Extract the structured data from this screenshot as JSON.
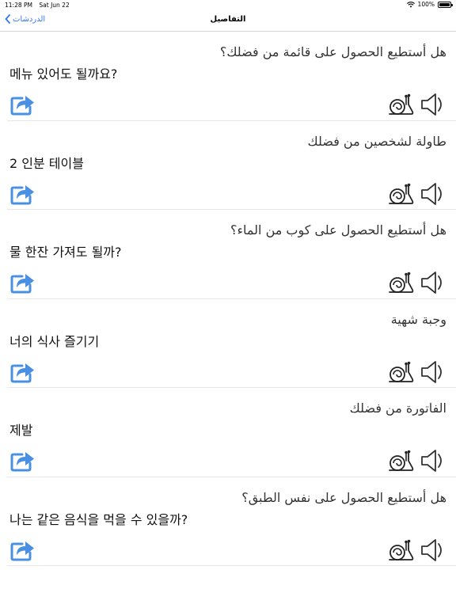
{
  "status": {
    "time": "11:28 PM",
    "date": "Sat Jun 22",
    "battery": "100%"
  },
  "nav": {
    "back_label": "الدردشات",
    "title": "التفاصيل"
  },
  "phrases": [
    {
      "arabic": "هل أستطيع الحصول على قائمة من فضلك؟",
      "korean": "메뉴 있어도 될까요?"
    },
    {
      "arabic": "طاولة لشخصين من فضلك",
      "korean": "2 인분 테이블"
    },
    {
      "arabic": "هل أستطيع الحصول على كوب من الماء؟",
      "korean": "물 한잔 가져도 될까?"
    },
    {
      "arabic": "وجبة شهية",
      "korean": "너의 식사 즐기기"
    },
    {
      "arabic": "الفاتورة من فضلك",
      "korean": "제발"
    },
    {
      "arabic": "هل أستطيع الحصول على نفس الطبق؟",
      "korean": "나는 같은 음식을 먹을 수 있을까?"
    }
  ],
  "colors": {
    "accent": "#3478f6",
    "share_icon": "#4a90e2",
    "divider": "#e6e6e6"
  },
  "icons": {
    "share": "share-arrow-icon",
    "slow": "snail-icon",
    "play": "speaker-icon"
  }
}
